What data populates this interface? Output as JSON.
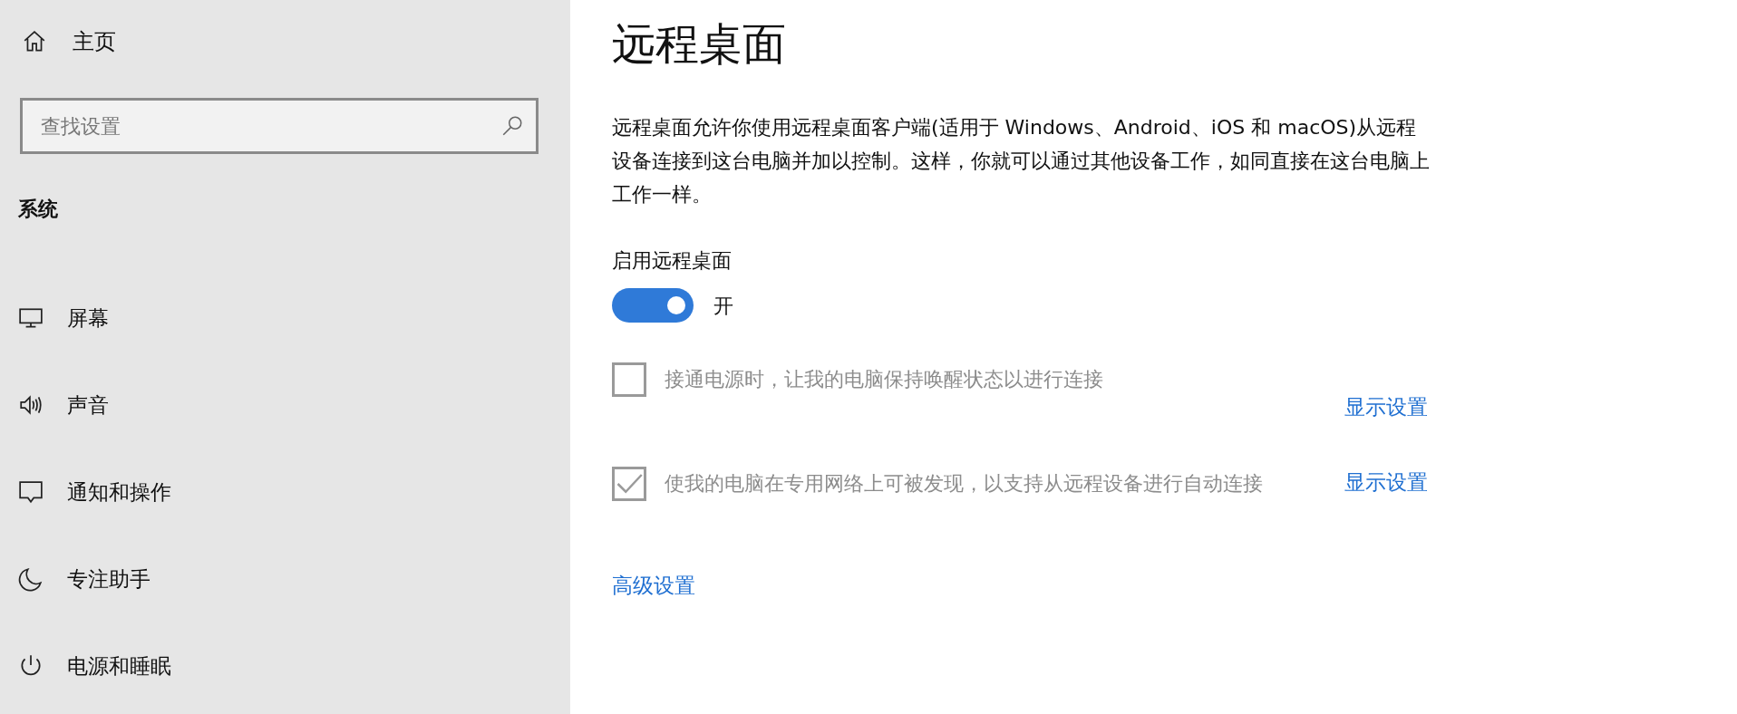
{
  "sidebar": {
    "home": {
      "label": "主页"
    },
    "search": {
      "placeholder": "查找设置"
    },
    "section": "系统",
    "items": [
      {
        "kind": "display",
        "label": "屏幕"
      },
      {
        "kind": "sound",
        "label": "声音"
      },
      {
        "kind": "notifications",
        "label": "通知和操作"
      },
      {
        "kind": "focus",
        "label": "专注助手"
      },
      {
        "kind": "power",
        "label": "电源和睡眠"
      }
    ]
  },
  "main": {
    "title": "远程桌面",
    "description": "远程桌面允许你使用远程桌面客户端(适用于 Windows、Android、iOS 和 macOS)从远程设备连接到这台电脑并加以控制。这样，你就可以通过其他设备工作，如同直接在这台电脑上工作一样。",
    "toggle": {
      "label": "启用远程桌面",
      "on": true,
      "state_text": "开"
    },
    "options": [
      {
        "label": "接通电源时，让我的电脑保持唤醒状态以进行连接",
        "checked": false,
        "disabled": true,
        "link": "显示设置"
      },
      {
        "label": "使我的电脑在专用网络上可被发现，以支持从远程设备进行自动连接",
        "checked": true,
        "disabled": true,
        "link": "显示设置"
      }
    ],
    "advanced_link": "高级设置"
  }
}
